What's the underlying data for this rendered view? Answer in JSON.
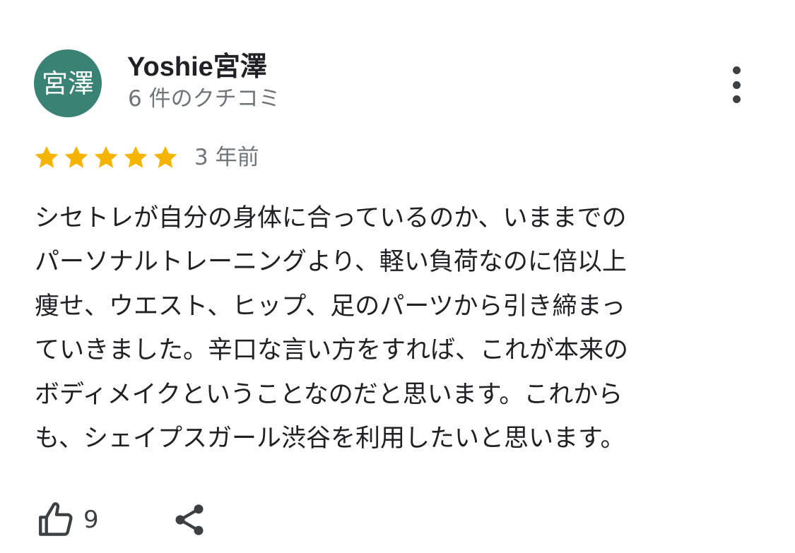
{
  "reviewer": {
    "avatar_text": "宮澤",
    "avatar_color": "#3a8274",
    "name": "Yoshie宮澤",
    "review_count": "6 件のクチコミ"
  },
  "menu": {
    "icon": "more-vertical-icon"
  },
  "review": {
    "rating": 5,
    "max_rating": 5,
    "star_color": "#f4b400",
    "time_ago": "3 年前",
    "text": "シセトレが自分の身体に合っているのか、いままでの\nパーソナルトレーニングより、軽い負荷なのに倍以上\n痩せ、ウエスト、ヒップ、足のパーツから引き締まっ\nていきました。辛口な言い方をすれば、これが本来の\nボディメイクということなのだと思います。これから\nも、シェイプスガール渋谷を利用したいと思います。"
  },
  "actions": {
    "like_icon": "thumbs-up-icon",
    "like_count": "9",
    "share_icon": "share-icon"
  }
}
